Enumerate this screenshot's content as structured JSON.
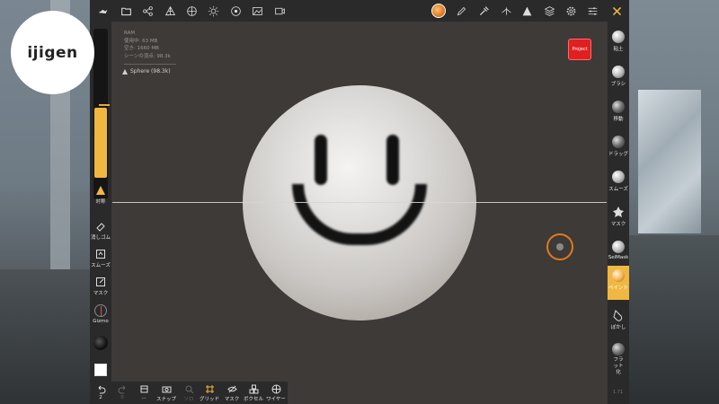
{
  "logo": {
    "text": "ijigen"
  },
  "stats": {
    "ram": "RAM",
    "used": "使用中: 63 MB",
    "free": "空き: 1660 MB",
    "vertices": "シーンの頂点: 98.3k"
  },
  "mesh": {
    "label": "Sphere (98.3k)"
  },
  "project_button": {
    "label": "Project"
  },
  "topbar": {
    "icons": [
      "wrench-icon",
      "folder-icon",
      "scene-tree-icon",
      "topology-icon",
      "material-icon",
      "light-icon",
      "postprocess-icon",
      "background-icon",
      "video-icon",
      "paint-color-icon",
      "pen-icon",
      "picker-icon",
      "symmetry-icon",
      "triangle-icon",
      "layers-icon",
      "settings-icon",
      "sliders-icon",
      "tools-icon"
    ],
    "sub_label": "..."
  },
  "leftbar": {
    "symmetry": "対称",
    "eraser": "消しゴム",
    "smooth": "スムーズ",
    "mask": "マスク",
    "gizmo": "Gizmo"
  },
  "bottombar": {
    "undo_count": "2",
    "redo_count": "0",
    "sub_dots": "...",
    "snap": "スナップ",
    "solo": "ソロ",
    "grid": "グリッド",
    "mask": "マスク",
    "voxel": "ボクセル",
    "wire": "ワイヤー"
  },
  "rightbar": {
    "items": [
      {
        "label": "粘土"
      },
      {
        "label": "ブラシ"
      },
      {
        "label": "移動"
      },
      {
        "label": "ドラッグ"
      },
      {
        "label": "スムーズ"
      },
      {
        "label": "マスク"
      },
      {
        "label": "SelMask"
      },
      {
        "label": "ペイント"
      },
      {
        "label": "ぼかし"
      },
      {
        "label": "フラット化"
      }
    ],
    "active_index": 7
  },
  "version": "1.71",
  "colors": {
    "accent": "#f0b840",
    "project_button": "#e02020",
    "cursor_ring": "#e07a1f",
    "toolbar_bg": "#2a2a2b",
    "viewport_bg": "#3d3a38"
  }
}
